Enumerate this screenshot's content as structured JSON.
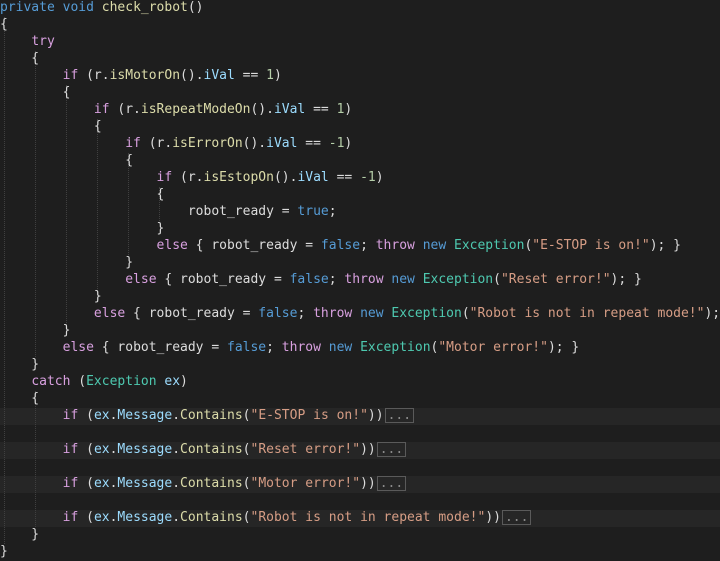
{
  "editor": {
    "lines": [
      [
        {
          "t": "private",
          "c": "kw"
        },
        {
          "t": " "
        },
        {
          "t": "void",
          "c": "kw"
        },
        {
          "t": " "
        },
        {
          "t": "check_robot",
          "c": "fn"
        },
        {
          "t": "()"
        }
      ],
      [
        {
          "t": "{"
        }
      ],
      [
        {
          "t": "    "
        },
        {
          "t": "try",
          "c": "kw2"
        }
      ],
      [
        {
          "t": "    {"
        }
      ],
      [
        {
          "t": "        "
        },
        {
          "t": "if",
          "c": "kw2"
        },
        {
          "t": " (r."
        },
        {
          "t": "isMotorOn",
          "c": "fn"
        },
        {
          "t": "()."
        },
        {
          "t": "iVal",
          "c": "var"
        },
        {
          "t": " == "
        },
        {
          "t": "1",
          "c": "num"
        },
        {
          "t": ")"
        }
      ],
      [
        {
          "t": "        {"
        }
      ],
      [
        {
          "t": "            "
        },
        {
          "t": "if",
          "c": "kw2"
        },
        {
          "t": " (r."
        },
        {
          "t": "isRepeatModeOn",
          "c": "fn"
        },
        {
          "t": "()."
        },
        {
          "t": "iVal",
          "c": "var"
        },
        {
          "t": " == "
        },
        {
          "t": "1",
          "c": "num"
        },
        {
          "t": ")"
        }
      ],
      [
        {
          "t": "            {"
        }
      ],
      [
        {
          "t": "                "
        },
        {
          "t": "if",
          "c": "kw2"
        },
        {
          "t": " (r."
        },
        {
          "t": "isErrorOn",
          "c": "fn"
        },
        {
          "t": "()."
        },
        {
          "t": "iVal",
          "c": "var"
        },
        {
          "t": " == "
        },
        {
          "t": "-1",
          "c": "num"
        },
        {
          "t": ")"
        }
      ],
      [
        {
          "t": "                {"
        }
      ],
      [
        {
          "t": "                    "
        },
        {
          "t": "if",
          "c": "kw2"
        },
        {
          "t": " (r."
        },
        {
          "t": "isEstopOn",
          "c": "fn"
        },
        {
          "t": "()."
        },
        {
          "t": "iVal",
          "c": "var"
        },
        {
          "t": " == "
        },
        {
          "t": "-1",
          "c": "num"
        },
        {
          "t": ")"
        }
      ],
      [
        {
          "t": "                    {"
        }
      ],
      [
        {
          "t": "                        "
        },
        {
          "t": "robot_ready",
          "c": "pl"
        },
        {
          "t": " = "
        },
        {
          "t": "true",
          "c": "kw"
        },
        {
          "t": ";"
        }
      ],
      [
        {
          "t": "                    }"
        }
      ],
      [
        {
          "t": "                    "
        },
        {
          "t": "else",
          "c": "kw2"
        },
        {
          "t": " { robot_ready = "
        },
        {
          "t": "false",
          "c": "kw"
        },
        {
          "t": "; "
        },
        {
          "t": "throw",
          "c": "kw2"
        },
        {
          "t": " "
        },
        {
          "t": "new",
          "c": "kw"
        },
        {
          "t": " "
        },
        {
          "t": "Exception",
          "c": "type"
        },
        {
          "t": "("
        },
        {
          "t": "\"E-STOP is on!\"",
          "c": "str"
        },
        {
          "t": "); }"
        }
      ],
      [
        {
          "t": "                }"
        }
      ],
      [
        {
          "t": "                "
        },
        {
          "t": "else",
          "c": "kw2"
        },
        {
          "t": " { robot_ready = "
        },
        {
          "t": "false",
          "c": "kw"
        },
        {
          "t": "; "
        },
        {
          "t": "throw",
          "c": "kw2"
        },
        {
          "t": " "
        },
        {
          "t": "new",
          "c": "kw"
        },
        {
          "t": " "
        },
        {
          "t": "Exception",
          "c": "type"
        },
        {
          "t": "("
        },
        {
          "t": "\"Reset error!\"",
          "c": "str"
        },
        {
          "t": "); }"
        }
      ],
      [
        {
          "t": "            }"
        }
      ],
      [
        {
          "t": "            "
        },
        {
          "t": "else",
          "c": "kw2"
        },
        {
          "t": " { robot_ready = "
        },
        {
          "t": "false",
          "c": "kw"
        },
        {
          "t": "; "
        },
        {
          "t": "throw",
          "c": "kw2"
        },
        {
          "t": " "
        },
        {
          "t": "new",
          "c": "kw"
        },
        {
          "t": " "
        },
        {
          "t": "Exception",
          "c": "type"
        },
        {
          "t": "("
        },
        {
          "t": "\"Robot is not in repeat mode!\"",
          "c": "str"
        },
        {
          "t": "); }"
        }
      ],
      [
        {
          "t": "        }"
        }
      ],
      [
        {
          "t": "        "
        },
        {
          "t": "else",
          "c": "kw2"
        },
        {
          "t": " { robot_ready = "
        },
        {
          "t": "false",
          "c": "kw"
        },
        {
          "t": "; "
        },
        {
          "t": "throw",
          "c": "kw2"
        },
        {
          "t": " "
        },
        {
          "t": "new",
          "c": "kw"
        },
        {
          "t": " "
        },
        {
          "t": "Exception",
          "c": "type"
        },
        {
          "t": "("
        },
        {
          "t": "\"Motor error!\"",
          "c": "str"
        },
        {
          "t": "); }"
        }
      ],
      [
        {
          "t": "    }"
        }
      ],
      [
        {
          "t": "    "
        },
        {
          "t": "catch",
          "c": "kw2"
        },
        {
          "t": " ("
        },
        {
          "t": "Exception",
          "c": "type"
        },
        {
          "t": " "
        },
        {
          "t": "ex",
          "c": "var"
        },
        {
          "t": ")"
        }
      ],
      [
        {
          "t": "    {"
        }
      ],
      [
        {
          "t": "        "
        },
        {
          "t": "if",
          "c": "kw2"
        },
        {
          "t": " ("
        },
        {
          "t": "ex",
          "c": "var"
        },
        {
          "t": "."
        },
        {
          "t": "Message",
          "c": "var"
        },
        {
          "t": "."
        },
        {
          "t": "Contains",
          "c": "fn"
        },
        {
          "t": "("
        },
        {
          "t": "\"E-STOP is on!\"",
          "c": "str"
        },
        {
          "t": "))"
        },
        {
          "t": "...",
          "c": "collapsed"
        }
      ],
      [
        {
          "t": "        "
        },
        {
          "t": "if",
          "c": "kw2"
        },
        {
          "t": " ("
        },
        {
          "t": "ex",
          "c": "var"
        },
        {
          "t": "."
        },
        {
          "t": "Message",
          "c": "var"
        },
        {
          "t": "."
        },
        {
          "t": "Contains",
          "c": "fn"
        },
        {
          "t": "("
        },
        {
          "t": "\"Reset error!\"",
          "c": "str"
        },
        {
          "t": "))"
        },
        {
          "t": "...",
          "c": "collapsed"
        }
      ],
      [
        {
          "t": "        "
        },
        {
          "t": "if",
          "c": "kw2"
        },
        {
          "t": " ("
        },
        {
          "t": "ex",
          "c": "var"
        },
        {
          "t": "."
        },
        {
          "t": "Message",
          "c": "var"
        },
        {
          "t": "."
        },
        {
          "t": "Contains",
          "c": "fn"
        },
        {
          "t": "("
        },
        {
          "t": "\"Motor error!\"",
          "c": "str"
        },
        {
          "t": "))"
        },
        {
          "t": "...",
          "c": "collapsed"
        }
      ],
      [
        {
          "t": "        "
        },
        {
          "t": "if",
          "c": "kw2"
        },
        {
          "t": " ("
        },
        {
          "t": "ex",
          "c": "var"
        },
        {
          "t": "."
        },
        {
          "t": "Message",
          "c": "var"
        },
        {
          "t": "."
        },
        {
          "t": "Contains",
          "c": "fn"
        },
        {
          "t": "("
        },
        {
          "t": "\"Robot is not in repeat mode!\"",
          "c": "str"
        },
        {
          "t": "))"
        },
        {
          "t": "...",
          "c": "collapsed"
        }
      ],
      [
        {
          "t": "    }"
        }
      ],
      [
        {
          "t": "}"
        }
      ]
    ]
  }
}
